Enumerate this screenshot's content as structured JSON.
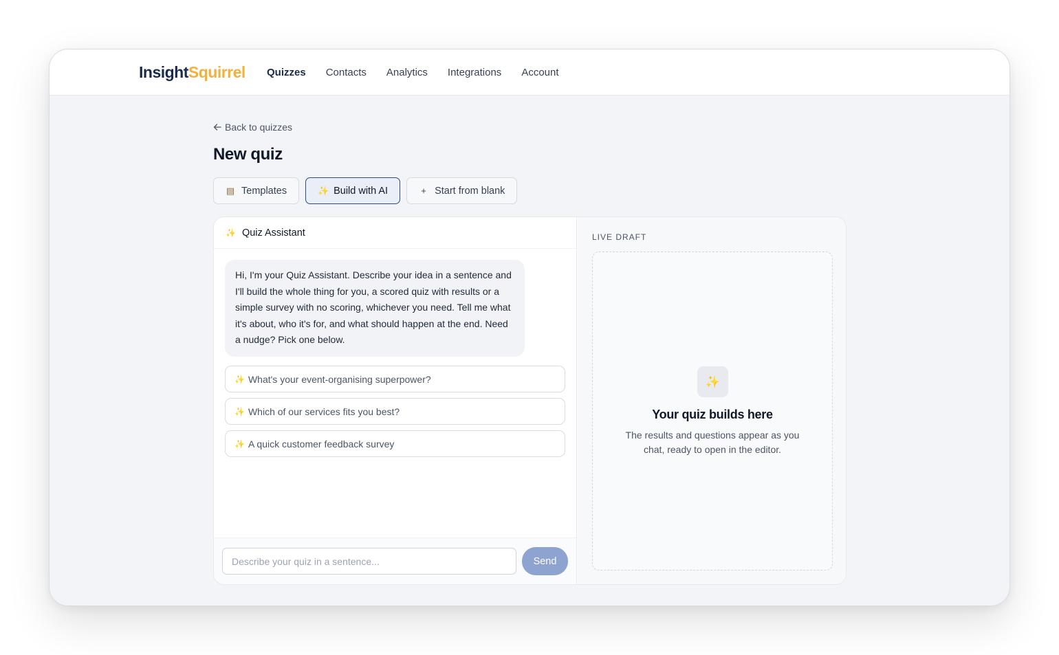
{
  "brand": {
    "part1": "Insight",
    "part2": "Squirrel"
  },
  "nav": {
    "items": [
      {
        "label": "Quizzes",
        "active": true
      },
      {
        "label": "Contacts",
        "active": false
      },
      {
        "label": "Analytics",
        "active": false
      },
      {
        "label": "Integrations",
        "active": false
      },
      {
        "label": "Account",
        "active": false
      }
    ]
  },
  "back_link": "Back to quizzes",
  "page_title": "New quiz",
  "mode_tabs": [
    {
      "label": "Templates",
      "icon": "clipboard-icon"
    },
    {
      "label": "Build with AI",
      "icon": "sparkle-icon",
      "active": true
    },
    {
      "label": "Start from blank",
      "icon": "plus-icon"
    }
  ],
  "assistant": {
    "title": "Quiz Assistant",
    "message": "Hi, I'm your Quiz Assistant. Describe your idea in a sentence and I'll build the whole thing for you, a scored quiz with results or a simple survey with no scoring, whichever you need. Tell me what it's about, who it's for, and what should happen at the end. Need a nudge? Pick one below.",
    "suggestions": [
      "What's your event-organising superpower?",
      "Which of our services fits you best?",
      "A quick customer feedback survey"
    ],
    "input_placeholder": "Describe your quiz in a sentence...",
    "send_label": "Send"
  },
  "draft": {
    "label": "LIVE DRAFT",
    "title": "Your quiz builds here",
    "text": "The results and questions appear as you chat, ready to open in the editor."
  },
  "colors": {
    "brand_dark": "#1b2b4b",
    "brand_accent": "#f0b23a",
    "send_button": "#8ea3cf",
    "active_tab_border": "#2c4a7c"
  }
}
